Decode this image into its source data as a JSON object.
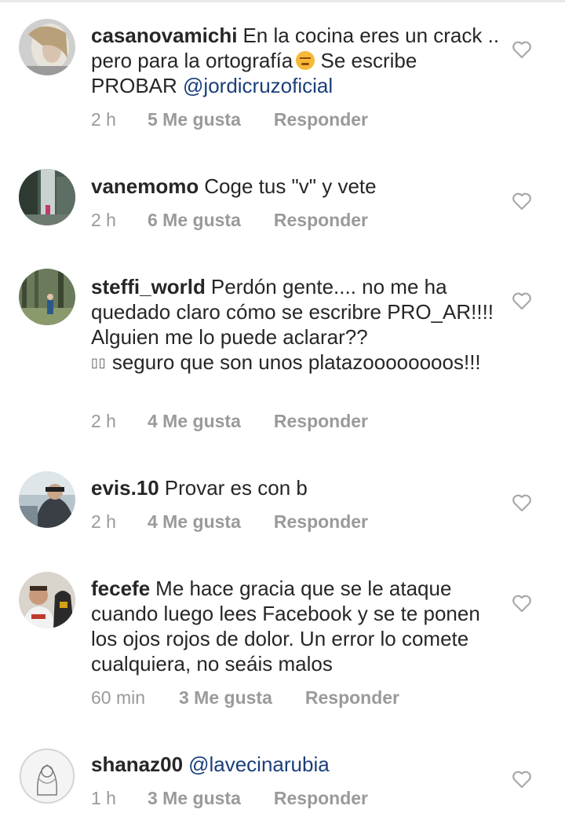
{
  "comments": [
    {
      "username": "casanovamichi",
      "text_before_emoji": "En la cocina eres un crack .. pero para la ortografía",
      "emoji": "angry-face-emoji",
      "text_after_emoji": " Se escribe PROBAR ",
      "mention": "@jordicruzoficial",
      "time": "2 h",
      "likes": "5 Me gusta",
      "reply": "Responder"
    },
    {
      "username": "vanemomo",
      "text": "Coge tus \"v\" y vete",
      "time": "2 h",
      "likes": "6 Me gusta",
      "reply": "Responder"
    },
    {
      "username": "steffi_world",
      "text": "Perdón gente.... no me ha quedado claro cómo se escribre PRO_AR!!!! Alguien me lo puede aclarar??",
      "boxes": "▯▯",
      "text_after_boxes": " seguro que son unos platazoooooooos!!!",
      "time": "2 h",
      "likes": "4 Me gusta",
      "reply": "Responder"
    },
    {
      "username": "evis.10",
      "text": "Provar es con b",
      "time": "2 h",
      "likes": "4 Me gusta",
      "reply": "Responder"
    },
    {
      "username": "fecefe",
      "text": "Me hace gracia que se le ataque cuando luego lees Facebook y se te ponen los ojos rojos de dolor. Un error lo comete cualquiera, no seáis malos",
      "time": "60 min",
      "likes": "3 Me gusta",
      "reply": "Responder"
    },
    {
      "username": "shanaz00",
      "mention": "@lavecinarubia",
      "time": "1 h",
      "likes": "3 Me gusta",
      "reply": "Responder"
    }
  ],
  "icons": {
    "like": "heart-outline-icon",
    "avatar": "avatar-photo"
  },
  "colors": {
    "text": "#262626",
    "meta": "#9a9a9a",
    "mention": "#1a3f7a",
    "heart": "#a8a8a8"
  }
}
